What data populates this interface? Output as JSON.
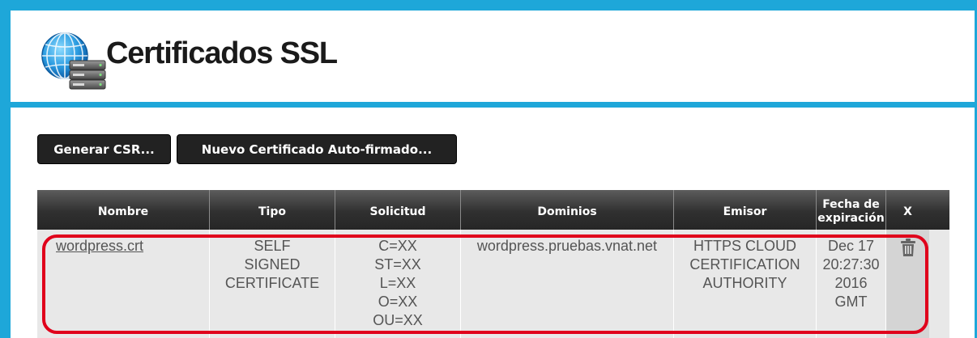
{
  "header": {
    "title": "Certificados SSL",
    "logo_icon": "globe-server-icon"
  },
  "toolbar": {
    "generate_csr_label": "Generar CSR...",
    "new_self_signed_label": "Nuevo Certificado Auto-firmado..."
  },
  "table": {
    "columns": {
      "nombre": "Nombre",
      "tipo": "Tipo",
      "solicitud": "Solicitud",
      "dominios": "Dominios",
      "emisor": "Emisor",
      "expiracion_1": "Fecha de",
      "expiracion_2": "expiración",
      "delete": "X"
    },
    "rows": [
      {
        "nombre": "wordpress.crt",
        "tipo": [
          "SELF",
          "SIGNED",
          "CERTIFICATE"
        ],
        "solicitud": [
          "C=XX",
          "ST=XX",
          "L=XX",
          "O=XX",
          "OU=XX"
        ],
        "dominios": "wordpress.pruebas.vnat.net",
        "emisor": [
          "HTTPS CLOUD",
          "CERTIFICATION",
          "AUTHORITY"
        ],
        "expiracion": [
          "Dec 17",
          "20:27:30",
          "2016",
          "GMT"
        ],
        "delete_icon": "trash-icon"
      }
    ]
  },
  "colors": {
    "frame_blue": "#1ea7d9",
    "highlight_red": "#e0001b",
    "button_dark": "#222222"
  }
}
